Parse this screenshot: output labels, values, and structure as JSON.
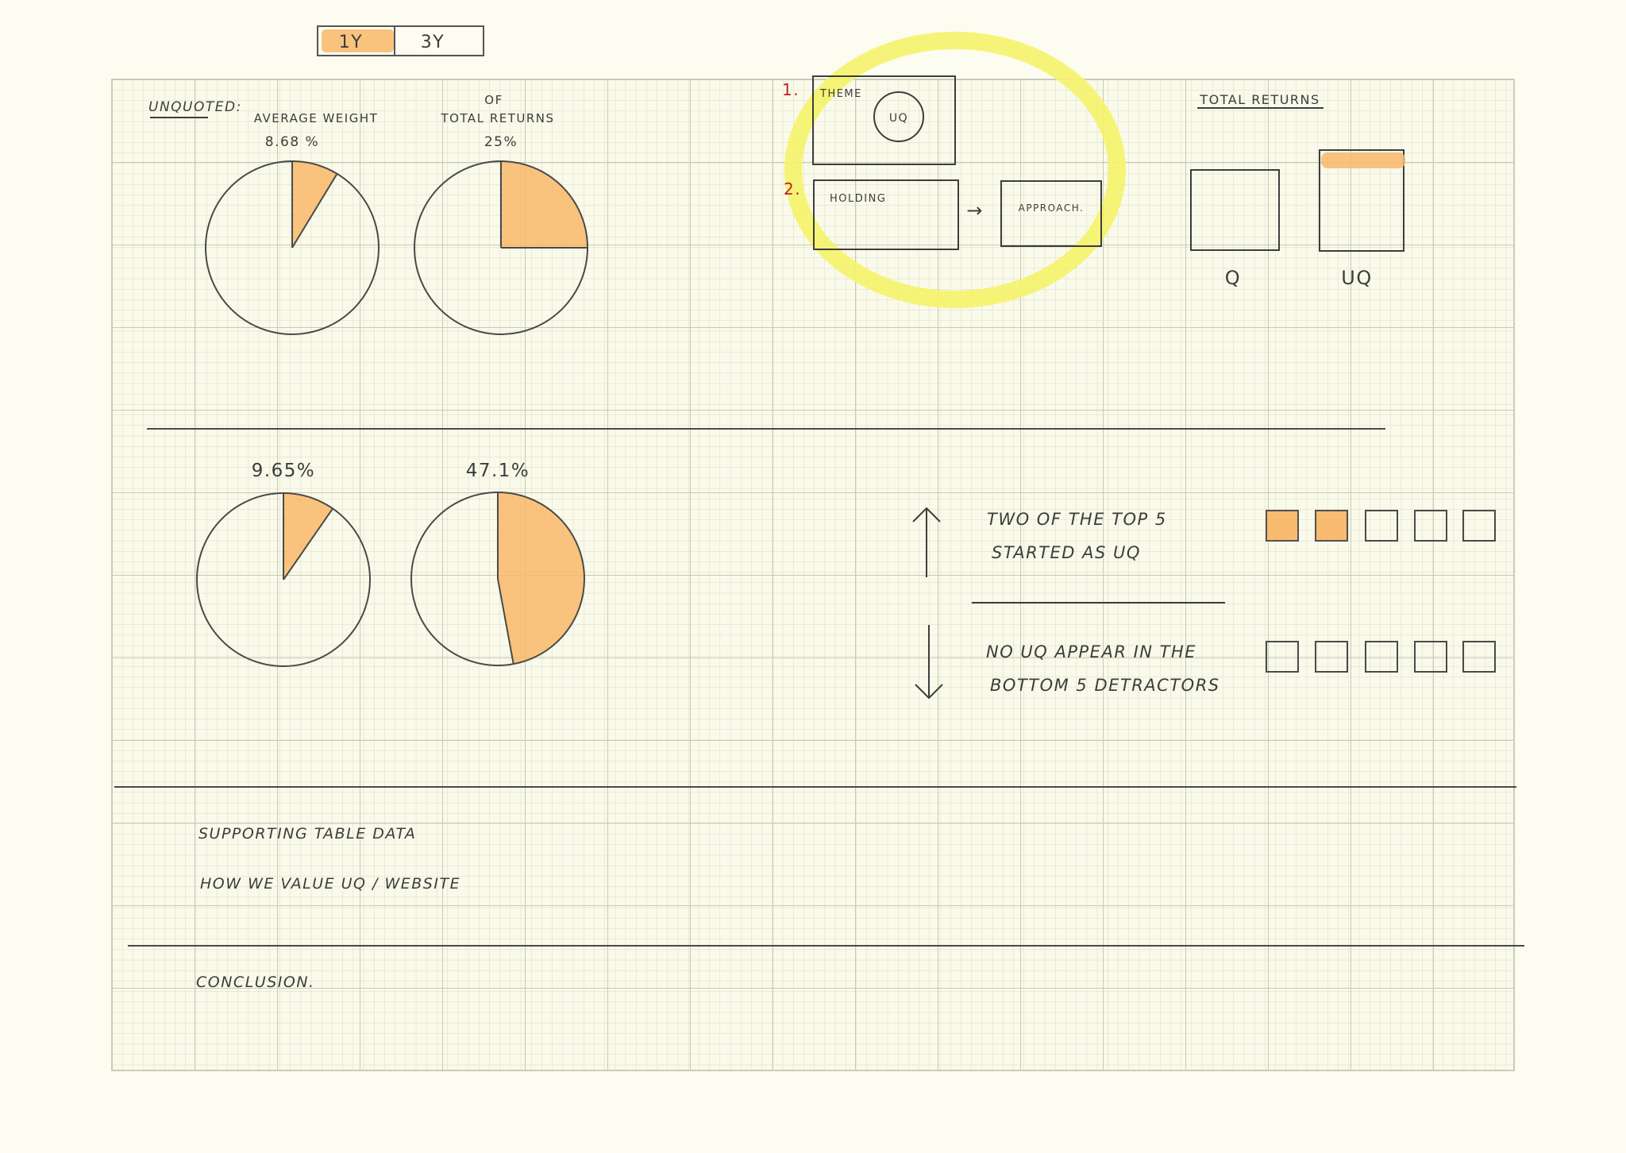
{
  "toggle": {
    "options": [
      "1Y",
      "3Y"
    ],
    "selected": "1Y"
  },
  "colors": {
    "paper": "#fdfcf0",
    "ink": "#3d3d3d",
    "orange": "#f8b86a",
    "yellow": "#f5f36a",
    "red_number": "#c0202a",
    "grid": "#d4d6c4"
  },
  "unquoted": {
    "label": "UNQUOTED:",
    "weight_label": "AVERAGE WEIGHT",
    "returns_label_line1": "OF",
    "returns_label_line2": "TOTAL RETURNS"
  },
  "chart_data": [
    {
      "type": "pie",
      "group": "1Y",
      "title": "AVERAGE WEIGHT",
      "value_label": "8.68 %",
      "values": [
        8.68,
        91.32
      ]
    },
    {
      "type": "pie",
      "group": "1Y",
      "title": "OF TOTAL RETURNS",
      "value_label": "25%",
      "values": [
        25,
        75
      ]
    },
    {
      "type": "pie",
      "group": "3Y",
      "value_label": "9.65%",
      "values": [
        9.65,
        90.35
      ]
    },
    {
      "type": "pie",
      "group": "3Y",
      "value_label": "47.1%",
      "values": [
        47.1,
        52.9
      ]
    }
  ],
  "diagram": {
    "step1_number": "1.",
    "step1_label": "THEME",
    "step1_circle": "UQ",
    "step2_number": "2.",
    "step2_label": "HOLDING",
    "step2_arrow": "→",
    "step2_target": "APPROACH."
  },
  "total_returns": {
    "title": "TOTAL RETURNS",
    "labels": [
      "Q",
      "UQ"
    ]
  },
  "top5": {
    "line1": "TWO OF THE TOP 5",
    "line2": "STARTED AS UQ",
    "boxes": [
      true,
      true,
      false,
      false,
      false
    ]
  },
  "bottom5": {
    "line1": "NO UQ APPEAR IN THE",
    "line2": "BOTTOM 5 DETRACTORS",
    "boxes": [
      false,
      false,
      false,
      false,
      false
    ]
  },
  "notes": {
    "supporting": "SUPPORTING TABLE DATA",
    "value_uq": "HOW WE VALUE UQ / WEBSITE",
    "conclusion": "CONCLUSION."
  }
}
